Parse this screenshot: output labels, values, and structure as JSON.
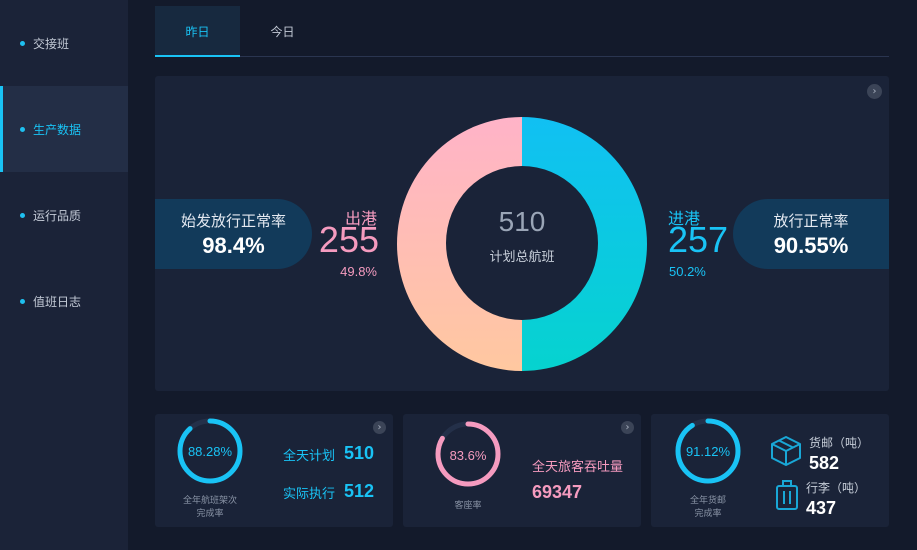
{
  "sidebar": {
    "items": [
      {
        "label": "交接班"
      },
      {
        "label": "生产数据"
      },
      {
        "label": "运行品质"
      },
      {
        "label": "值班日志"
      }
    ]
  },
  "tabs": [
    {
      "label": "昨日"
    },
    {
      "label": "今日"
    }
  ],
  "main": {
    "left_pill": {
      "label": "始发放行正常率",
      "value": "98.4%"
    },
    "right_pill": {
      "label": "放行正常率",
      "value": "90.55%"
    },
    "departure": {
      "label": "出港",
      "value": "255",
      "percent": "49.8%"
    },
    "arrival": {
      "label": "进港",
      "value": "257",
      "percent": "50.2%"
    },
    "center": {
      "value": "510",
      "label": "计划总航班"
    }
  },
  "cards": {
    "flights": {
      "ring_value": "88.28%",
      "ring_fraction": 0.8828,
      "caption_line1": "全年航班架次",
      "caption_line2": "完成率",
      "plan_label": "全天计划",
      "plan_value": "510",
      "actual_label": "实际执行",
      "actual_value": "512"
    },
    "passengers": {
      "ring_value": "83.6%",
      "ring_fraction": 0.836,
      "caption": "客座率",
      "throughput_label": "全天旅客吞吐量",
      "throughput_value": "69347"
    },
    "cargo": {
      "ring_value": "91.12%",
      "ring_fraction": 0.9112,
      "caption_line1": "全年货邮",
      "caption_line2": "完成率",
      "cargo_label": "货邮（吨）",
      "cargo_value": "582",
      "luggage_label": "行李（吨）",
      "luggage_value": "437"
    }
  },
  "colors": {
    "accent": "#19c3f5",
    "pink": "#f59bbf",
    "departure_gradient": [
      "#ffb3c8",
      "#ffc8a0"
    ],
    "arrival_gradient": [
      "#11c0f3",
      "#06d3cf"
    ]
  }
}
